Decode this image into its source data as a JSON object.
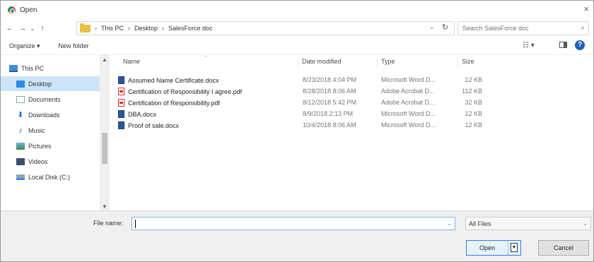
{
  "window": {
    "title": "Open",
    "close_glyph": "×"
  },
  "nav": {
    "back": "←",
    "forward": "→",
    "recent": "⌄",
    "up": "↑",
    "breadcrumb": [
      "This PC",
      "Desktop",
      "SalesForce doc"
    ],
    "refresh": "↻",
    "search_placeholder": "Search SalesForce doc",
    "search_icon": "⌕"
  },
  "toolbar": {
    "organize": "Organize ▾",
    "new_folder": "New folder",
    "view_glyph": "☷ ▾",
    "help_glyph": "?"
  },
  "sidebar": {
    "items": [
      {
        "label": "This PC",
        "icon": "computer-icon"
      },
      {
        "label": "Desktop",
        "icon": "desktop-icon"
      },
      {
        "label": "Documents",
        "icon": "documents-icon"
      },
      {
        "label": "Downloads",
        "icon": "downloads-icon"
      },
      {
        "label": "Music",
        "icon": "music-icon"
      },
      {
        "label": "Pictures",
        "icon": "pictures-icon"
      },
      {
        "label": "Videos",
        "icon": "videos-icon"
      },
      {
        "label": "Local Disk (C:)",
        "icon": "disk-icon"
      }
    ],
    "selected": "Desktop"
  },
  "columns": {
    "name": "Name",
    "date": "Date modified",
    "type": "Type",
    "size": "Size"
  },
  "files": [
    {
      "name": "Assumed Name Certificate.docx",
      "date": "8/23/2018 4:04 PM",
      "type": "Microsoft Word D...",
      "size": "12 KB",
      "kind": "word"
    },
    {
      "name": "Certification of Responsibility I agree.pdf",
      "date": "8/28/2018 8:06 AM",
      "type": "Adobe Acrobat D...",
      "size": "112 KB",
      "kind": "pdf"
    },
    {
      "name": "Certification of Responsibility.pdf",
      "date": "8/12/2018 5:42 PM",
      "type": "Adobe Acrobat D...",
      "size": "32 KB",
      "kind": "pdf"
    },
    {
      "name": "DBA.docx",
      "date": "8/9/2018 2:13 PM",
      "type": "Microsoft Word D...",
      "size": "12 KB",
      "kind": "word"
    },
    {
      "name": "Proof of sale.docx",
      "date": "10/4/2018 8:06 AM",
      "type": "Microsoft Word D...",
      "size": "12 KB",
      "kind": "word"
    }
  ],
  "bottom": {
    "file_name_label": "File name:",
    "file_name_value": "",
    "filter": "All Files",
    "open": "Open",
    "cancel": "Cancel"
  }
}
